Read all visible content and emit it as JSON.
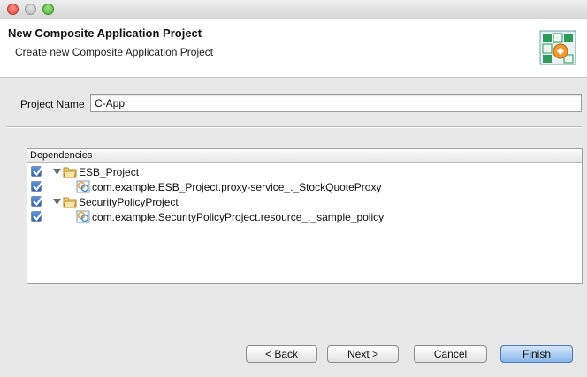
{
  "window": {
    "title": "New Composite Application Project",
    "subtitle": "Create new Composite Application Project"
  },
  "project_name": {
    "label": "Project Name",
    "value": "C-App"
  },
  "dependencies": {
    "header": "Dependencies",
    "items": [
      {
        "label": "ESB_Project",
        "checked": true,
        "level": 0,
        "expanded": true,
        "icon": "folder-icon"
      },
      {
        "label": "com.example.ESB_Project.proxy-service_._StockQuoteProxy",
        "checked": true,
        "level": 1,
        "icon": "artifact-icon"
      },
      {
        "label": "SecurityPolicyProject",
        "checked": true,
        "level": 0,
        "expanded": true,
        "icon": "folder-icon"
      },
      {
        "label": "com.example.SecurityPolicyProject.resource_._sample_policy",
        "checked": true,
        "level": 1,
        "icon": "artifact-icon"
      }
    ]
  },
  "buttons": {
    "back": "< Back",
    "next": "Next >",
    "cancel": "Cancel",
    "finish": "Finish"
  },
  "colors": {
    "accent": "#3d6fbf",
    "primary_button": "#8ab6ee"
  }
}
